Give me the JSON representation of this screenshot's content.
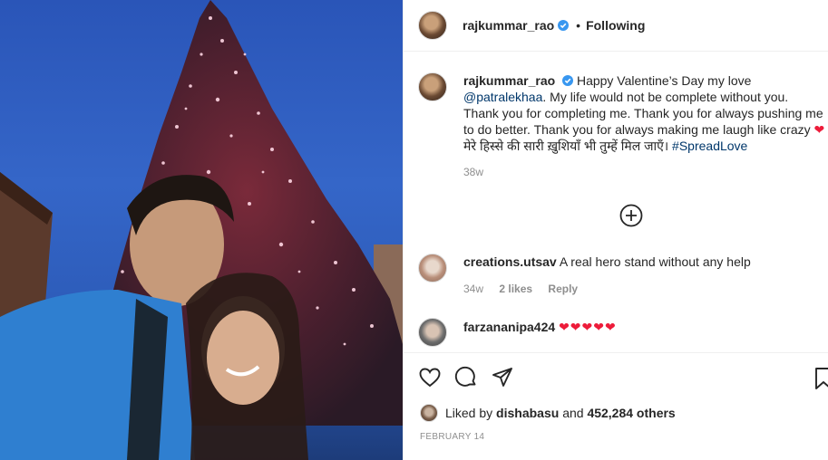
{
  "post": {
    "username": "rajkummar_rao",
    "follow_label": "Following",
    "separator": "•"
  },
  "caption": {
    "username": "rajkummar_rao",
    "text_1": "Happy Valentine’s Day my love ",
    "mention": "@patralekhaa",
    "text_2": ". My life would not be complete without you. Thank you for completing me. Thank you for always pushing me to do better. Thank you for always making me laugh like crazy ",
    "heart": "❤",
    "text_3": " मेरे हिस्से की सारी ख़ुशियाँ भी तुम्हें मिल जाएँ। ",
    "hashtag": "#SpreadLove",
    "time": "38w"
  },
  "comments": [
    {
      "username": "creations.utsav",
      "text": "A real hero stand without any help",
      "time": "34w",
      "likes": "2 likes",
      "reply": "Reply"
    },
    {
      "username": "farzananipa424",
      "text": "❤❤❤❤❤"
    }
  ],
  "likes": {
    "prefix": "Liked by",
    "user": "dishabasu",
    "middle": "and",
    "count": "452,284 others"
  },
  "date": "FEBRUARY 14",
  "icons": [
    "verified-badge-icon",
    "load-more-icon",
    "heart-icon",
    "comment-icon",
    "share-icon",
    "bookmark-icon"
  ],
  "colors": {
    "verified": "#3897f0",
    "link": "#00376b",
    "heart": "#ed1c3a",
    "muted": "#8e8e8e"
  }
}
